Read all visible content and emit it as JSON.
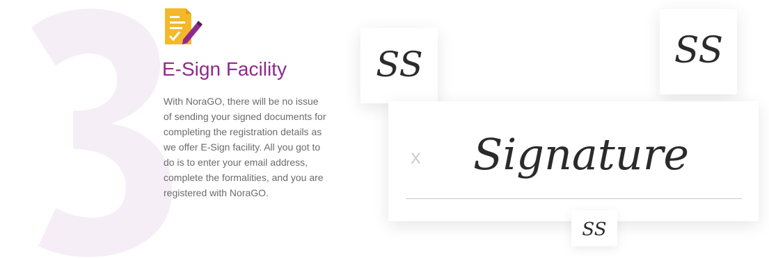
{
  "feature": {
    "step_number": "3",
    "title": "E-Sign Facility",
    "description": "With NoraGO, there will be no issue of sending your signed documents for completing the registration details as we offer E-Sign facility. All you got to do is to enter your email address, complete the formalities, and you are registered with NoraGO.",
    "icon": "document-sign-icon"
  },
  "signature_panel": {
    "x_mark": "X",
    "signature_text": "Signature",
    "initials": "SS"
  },
  "colors": {
    "title": "#8e2a8b",
    "body_text": "#6b6b6b",
    "step_number": "#f6eef7",
    "icon_yellow": "#f4b82b",
    "icon_purple": "#8e2a8b",
    "signature_ink": "#2b2b2b"
  }
}
